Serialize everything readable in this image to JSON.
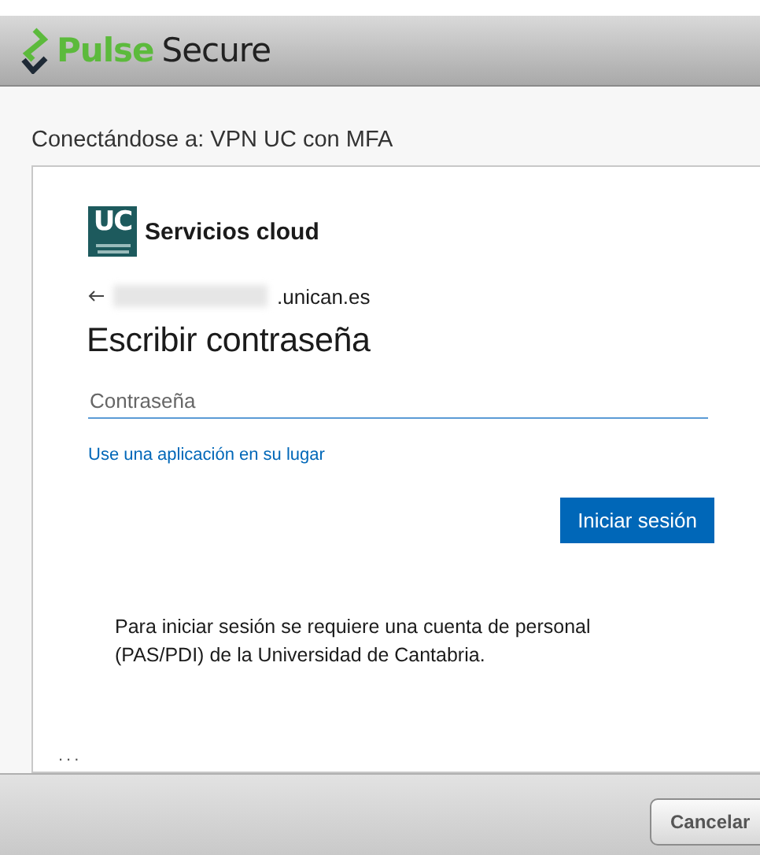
{
  "window": {
    "brand_first": "Pulse",
    "brand_second": "Secure"
  },
  "connecting_label": "Conectándose a: VPN UC con MFA",
  "signin": {
    "logo_text": "UC",
    "org_name": "Servicios cloud",
    "account_suffix": ".unican.es",
    "heading": "Escribir contraseña",
    "password": {
      "placeholder": "Contraseña"
    },
    "alt_link": "Use una aplicación en su lugar",
    "submit": "Iniciar sesión",
    "notice": "Para iniciar sesión se requiere una cuenta de personal (PAS/PDI) de la Universidad de Cantabria.",
    "more": "..."
  },
  "buttons": [
    "Cancelar"
  ]
}
